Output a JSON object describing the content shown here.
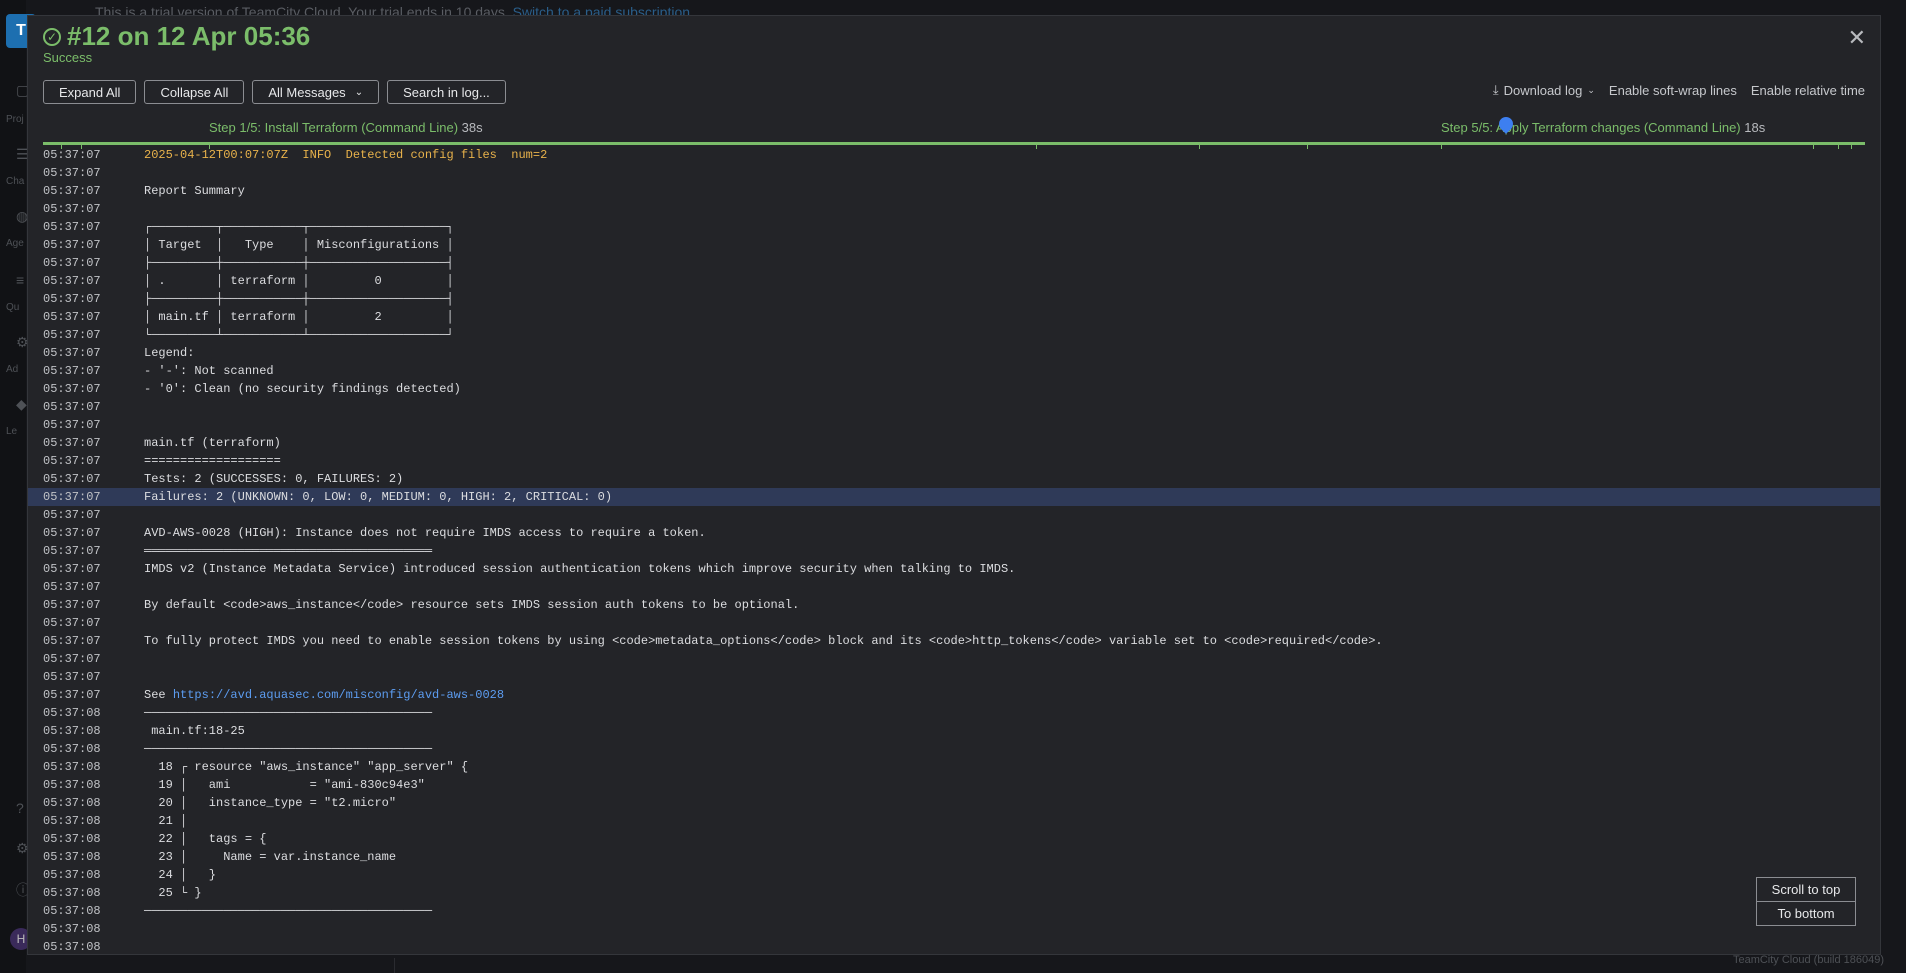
{
  "background": {
    "logo": "T",
    "trial_banner": "This is a trial version of TeamCity Cloud. Your trial ends in 10 days.",
    "trial_link": "Switch to a paid subscription",
    "nav_labels": [
      "Proj",
      "Cha",
      "Age",
      "Qu",
      "Ad",
      "Le"
    ],
    "avatar": "H",
    "footer": "TeamCity Cloud (build 186049)"
  },
  "header": {
    "title": "#12 on 12 Apr 05:36",
    "status": "Success",
    "status_icon": "check-circle-icon",
    "accent_color": "#7bbd6a"
  },
  "toolbar": {
    "expand_all": "Expand All",
    "collapse_all": "Collapse All",
    "messages_filter": "All Messages",
    "search": "Search in log...",
    "download_log": "Download log",
    "soft_wrap": "Enable soft-wrap lines",
    "relative_time": "Enable relative time"
  },
  "timeline": {
    "step1_label": "Step 1/5: Install Terraform (Command Line)",
    "step1_duration": "38s",
    "step5_label": "Step 5/5: Apply Terraform changes (Command Line)",
    "step5_duration": "18s"
  },
  "log": [
    {
      "time": "05:37:07",
      "text": "2025-04-12T00:07:07Z  INFO  Detected config files  num=2",
      "style": "warn"
    },
    {
      "time": "05:37:07",
      "text": ""
    },
    {
      "time": "05:37:07",
      "text": "Report Summary"
    },
    {
      "time": "05:37:07",
      "text": ""
    },
    {
      "time": "05:37:07",
      "text": "┌─────────┬───────────┬───────────────────┐"
    },
    {
      "time": "05:37:07",
      "text": "│ Target  │   Type    │ Misconfigurations │"
    },
    {
      "time": "05:37:07",
      "text": "├─────────┼───────────┼───────────────────┤"
    },
    {
      "time": "05:37:07",
      "text": "│ .       │ terraform │         0         │"
    },
    {
      "time": "05:37:07",
      "text": "├─────────┼───────────┼───────────────────┤"
    },
    {
      "time": "05:37:07",
      "text": "│ main.tf │ terraform │         2         │"
    },
    {
      "time": "05:37:07",
      "text": "└─────────┴───────────┴───────────────────┘"
    },
    {
      "time": "05:37:07",
      "text": "Legend:"
    },
    {
      "time": "05:37:07",
      "text": "- '-': Not scanned"
    },
    {
      "time": "05:37:07",
      "text": "- '0': Clean (no security findings detected)"
    },
    {
      "time": "05:37:07",
      "text": ""
    },
    {
      "time": "05:37:07",
      "text": ""
    },
    {
      "time": "05:37:07",
      "text": "main.tf (terraform)"
    },
    {
      "time": "05:37:07",
      "text": "==================="
    },
    {
      "time": "05:37:07",
      "text": "Tests: 2 (SUCCESSES: 0, FAILURES: 2)"
    },
    {
      "time": "05:37:07",
      "text": "Failures: 2 (UNKNOWN: 0, LOW: 0, MEDIUM: 0, HIGH: 2, CRITICAL: 0)",
      "highlight": true
    },
    {
      "time": "05:37:07",
      "text": ""
    },
    {
      "time": "05:37:07",
      "text": "AVD-AWS-0028 (HIGH): Instance does not require IMDS access to require a token."
    },
    {
      "time": "05:37:07",
      "text": "════════════════════════════════════════"
    },
    {
      "time": "05:37:07",
      "text": "IMDS v2 (Instance Metadata Service) introduced session authentication tokens which improve security when talking to IMDS."
    },
    {
      "time": "05:37:07",
      "text": ""
    },
    {
      "time": "05:37:07",
      "text": "By default <code>aws_instance</code> resource sets IMDS session auth tokens to be optional."
    },
    {
      "time": "05:37:07",
      "text": ""
    },
    {
      "time": "05:37:07",
      "text": "To fully protect IMDS you need to enable session tokens by using <code>metadata_options</code> block and its <code>http_tokens</code> variable set to <code>required</code>."
    },
    {
      "time": "05:37:07",
      "text": ""
    },
    {
      "time": "05:37:07",
      "text": ""
    },
    {
      "time": "05:37:07",
      "text": "See ",
      "link": "https://avd.aquasec.com/misconfig/avd-aws-0028"
    },
    {
      "time": "05:37:08",
      "text": "────────────────────────────────────────"
    },
    {
      "time": "05:37:08",
      "text": " main.tf:18-25"
    },
    {
      "time": "05:37:08",
      "text": "────────────────────────────────────────"
    },
    {
      "time": "05:37:08",
      "text": "  18 ┌ resource \"aws_instance\" \"app_server\" {"
    },
    {
      "time": "05:37:08",
      "text": "  19 │   ami           = \"ami-830c94e3\""
    },
    {
      "time": "05:37:08",
      "text": "  20 │   instance_type = \"t2.micro\""
    },
    {
      "time": "05:37:08",
      "text": "  21 │"
    },
    {
      "time": "05:37:08",
      "text": "  22 │   tags = {"
    },
    {
      "time": "05:37:08",
      "text": "  23 │     Name = var.instance_name"
    },
    {
      "time": "05:37:08",
      "text": "  24 │   }"
    },
    {
      "time": "05:37:08",
      "text": "  25 └ }"
    },
    {
      "time": "05:37:08",
      "text": "────────────────────────────────────────"
    },
    {
      "time": "05:37:08",
      "text": ""
    },
    {
      "time": "05:37:08",
      "text": ""
    }
  ],
  "scroll": {
    "to_top": "Scroll to top",
    "to_bottom": "To bottom"
  }
}
